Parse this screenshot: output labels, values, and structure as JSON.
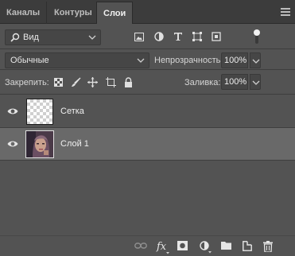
{
  "tabs": [
    {
      "label": "Каналы",
      "active": false
    },
    {
      "label": "Контуры",
      "active": false
    },
    {
      "label": "Слои",
      "active": true
    }
  ],
  "filter": {
    "kind_label": "Вид",
    "filter_icons": [
      "image-filter-icon",
      "adjustment-filter-icon",
      "type-filter-icon",
      "shape-filter-icon",
      "smart-object-filter-icon",
      "filter-toggle-icon"
    ]
  },
  "blend": {
    "mode": "Обычные",
    "opacity_label": "Непрозрачность:",
    "opacity_value": "100%"
  },
  "lock": {
    "label": "Закрепить:",
    "fill_label": "Заливка:",
    "fill_value": "100%"
  },
  "layers": [
    {
      "name": "Сетка",
      "visible": true,
      "selected": false,
      "thumbnail": "transparent"
    },
    {
      "name": "Слой 1",
      "visible": true,
      "selected": true,
      "thumbnail": "photo"
    }
  ],
  "bottom_icons": [
    "link-layers-icon",
    "fx-icon",
    "add-mask-icon",
    "new-adjustment-icon",
    "new-group-icon",
    "new-layer-icon",
    "delete-layer-icon"
  ],
  "colors": {
    "panel_bg": "#535353",
    "tabbar_bg": "#3c3c3c",
    "selected_layer": "#696969"
  }
}
